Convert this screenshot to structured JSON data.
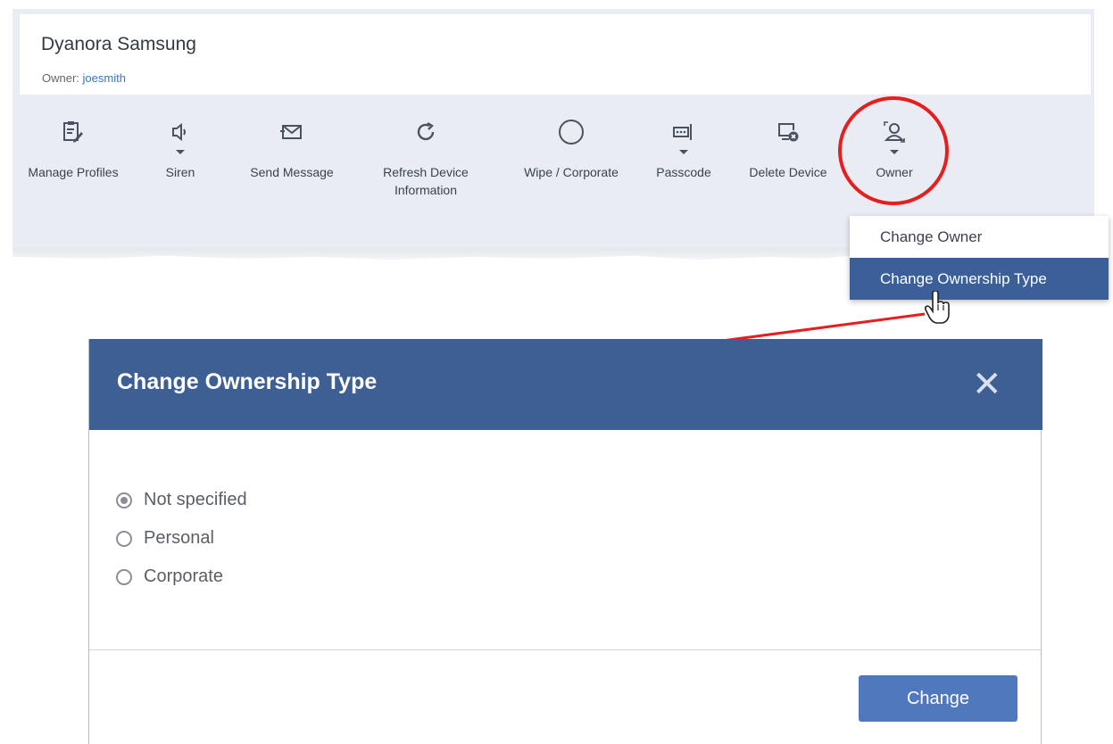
{
  "device": {
    "title": "Dyanora Samsung",
    "owner_prefix": "Owner: ",
    "owner_name": "joesmith"
  },
  "toolbar": {
    "manage_profiles": "Manage Profiles",
    "siren": "Siren",
    "send_message": "Send Message",
    "refresh_line1": "Refresh Device",
    "refresh_line2": "Information",
    "wipe": "Wipe / Corporate",
    "passcode": "Passcode",
    "delete_device": "Delete Device",
    "owner": "Owner"
  },
  "owner_menu": {
    "items": [
      {
        "label": "Change Owner"
      },
      {
        "label": "Change Ownership Type",
        "active": true
      }
    ]
  },
  "modal": {
    "title": "Change Ownership Type",
    "close": "✕",
    "options": [
      {
        "label": "Not specified",
        "checked": true
      },
      {
        "label": "Personal",
        "checked": false
      },
      {
        "label": "Corporate",
        "checked": false
      }
    ],
    "submit_label": "Change"
  },
  "colors": {
    "toolbar_bg": "#e9edf3",
    "modal_header": "#3e5f93",
    "menu_active": "#3a5f99",
    "primary_button": "#5078bd",
    "annotation_red": "#e51f1f",
    "link": "#2f77c9"
  },
  "icons": {
    "manage_profiles": "clipboard-edit-icon",
    "siren": "speaker-icon",
    "send_message": "envelope-icon",
    "refresh": "refresh-icon",
    "wipe": "circle-icon",
    "passcode": "keypad-icon",
    "delete_device": "device-delete-icon",
    "owner": "user-swap-icon",
    "cursor": "hand-pointer-icon"
  }
}
